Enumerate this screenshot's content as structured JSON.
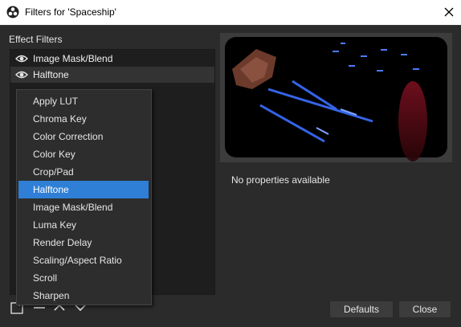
{
  "window": {
    "title": "Filters for 'Spaceship'"
  },
  "effect_filters": {
    "label": "Effect Filters",
    "items": [
      {
        "label": "Image Mask/Blend",
        "visible": true
      },
      {
        "label": "Halftone",
        "visible": true,
        "selected": true
      }
    ]
  },
  "menu": {
    "items": [
      "Apply LUT",
      "Chroma Key",
      "Color Correction",
      "Color Key",
      "Crop/Pad",
      "Halftone",
      "Image Mask/Blend",
      "Luma Key",
      "Render Delay",
      "Scaling/Aspect Ratio",
      "Scroll",
      "Sharpen"
    ],
    "highlighted": "Halftone"
  },
  "properties": {
    "empty_text": "No properties available"
  },
  "buttons": {
    "defaults": "Defaults",
    "close": "Close"
  },
  "colors": {
    "highlight": "#2f7fd7",
    "background": "#2b2b2b",
    "list_bg": "#1e1e1e"
  },
  "icons": {
    "app": "obs-logo-icon",
    "eye": "eye-icon",
    "add": "add-icon",
    "remove": "minus-icon",
    "up": "chevron-up-icon",
    "down": "chevron-down-icon",
    "close": "close-icon"
  }
}
